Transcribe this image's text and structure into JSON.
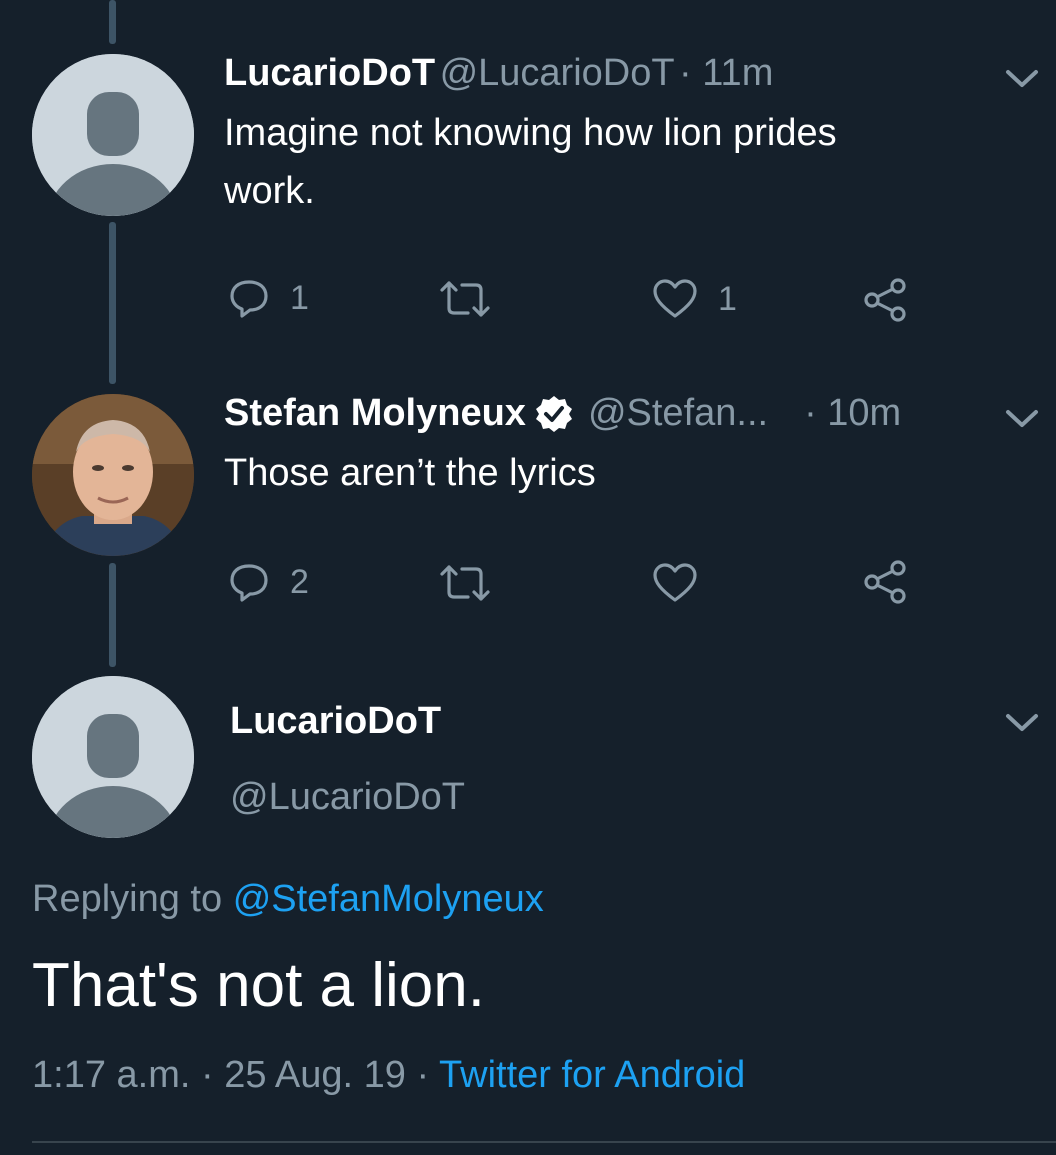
{
  "tweets": [
    {
      "name": "LucarioDoT",
      "handle": "@LucarioDoT",
      "time": "· 11m",
      "text_line1": "Imagine not knowing how lion prides",
      "text_line2": "work.",
      "replies": "1",
      "likes": "1"
    },
    {
      "name": "Stefan Molyneux",
      "handle": "@Stefan...",
      "time": "· 10m",
      "text": "Those aren’t the lyrics",
      "replies": "2"
    }
  ],
  "main_tweet": {
    "name": "LucarioDoT",
    "handle": "@LucarioDoT",
    "replying_prefix": "Replying to",
    "replying_to": "@StefanMolyneux",
    "text": "That's not a lion.",
    "time": "1:17 a.m.",
    "sep1": "·",
    "date": "25 Aug. 19",
    "sep2": "·",
    "source": "Twitter for Android"
  },
  "icons": [
    "reply-icon",
    "retweet-icon",
    "like-icon",
    "share-icon",
    "chevron-down-icon",
    "verified-badge-icon"
  ],
  "colors": {
    "background": "#15202b",
    "text": "#ffffff",
    "muted": "#8899a6",
    "link": "#1da1f2",
    "thread": "#3d5466"
  }
}
